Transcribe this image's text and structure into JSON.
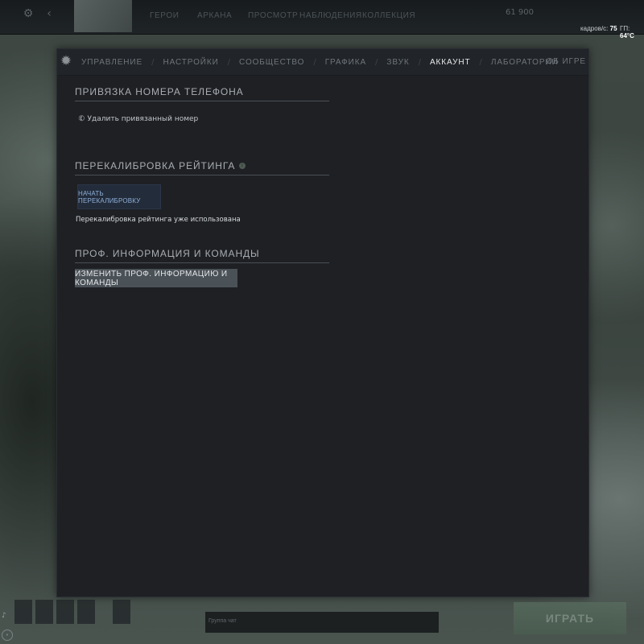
{
  "top_nav": {
    "items": [
      "ГЕРОИ",
      "АРКАНА",
      "ПРОСМОТР",
      "НАБЛЮДЕНИЯ",
      "КОЛЛЕКЦИЯ"
    ],
    "currency": "61 900",
    "fps_label": "кадров/с:",
    "fps_value": "75",
    "gpu_label": "ГП:",
    "gpu_value": "64°C"
  },
  "settings": {
    "tabs": [
      "УПРАВЛЕНИЕ",
      "НАСТРОЙКИ",
      "СООБЩЕСТВО",
      "ГРАФИКА",
      "ЗВУК",
      "АККАУНТ",
      "ЛАБОРАТОРИИ"
    ],
    "active_tab_index": 5,
    "separator": "/",
    "about_label": "ОБ ИГРЕ",
    "phone": {
      "title": "ПРИВЯЗКА НОМЕРА ТЕЛЕФОНА",
      "remove_link": "Удалить привязанный номер"
    },
    "recalibration": {
      "title": "ПЕРЕКАЛИБРОВКА РЕЙТИНГА",
      "info_glyph": "i",
      "button": "НАЧАТЬ ПЕРЕКАЛИБРОВКУ",
      "note": "Перекалибровка рейтинга уже использована"
    },
    "pro_info": {
      "title": "ПРОФ. ИНФОРМАЦИЯ И КОМАНДЫ",
      "button": "ИЗМЕНИТЬ ПРОФ. ИНФОРМАЦИЮ И КОМАНДЫ"
    }
  },
  "bottom": {
    "chat_text": "Группа чат",
    "play_button": "ИГРАТЬ"
  },
  "colors": {
    "panel_bg": "#1e2024",
    "active_tab": "#e6e8ea",
    "recal_button_bg": "#232c3b",
    "prof_button_bg": "#4a5157"
  },
  "icons": [
    "settings-gear-icon",
    "phone-icon",
    "info-icon",
    "mic-icon"
  ]
}
